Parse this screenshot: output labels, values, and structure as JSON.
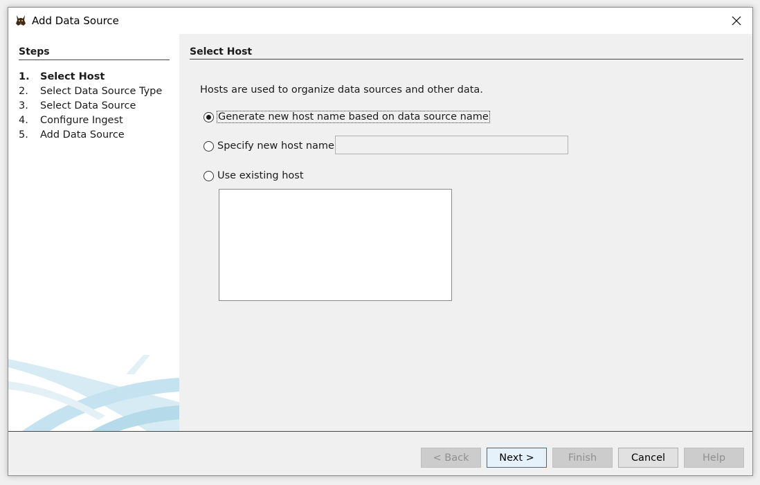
{
  "window": {
    "title": "Add Data Source",
    "icon": "autopsy-dog-icon",
    "close_glyph": "✕"
  },
  "steps": {
    "title": "Steps",
    "items": [
      {
        "number": "1.",
        "label": "Select Host",
        "current": true
      },
      {
        "number": "2.",
        "label": "Select Data Source Type",
        "current": false
      },
      {
        "number": "3.",
        "label": "Select Data Source",
        "current": false
      },
      {
        "number": "4.",
        "label": "Configure Ingest",
        "current": false
      },
      {
        "number": "5.",
        "label": "Add Data Source",
        "current": false
      }
    ]
  },
  "content": {
    "title": "Select Host",
    "intro": "Hosts are used to organize data sources and other data.",
    "options": [
      {
        "label": "Generate new host name based on data source name",
        "checked": true
      },
      {
        "label": "Specify new host name",
        "checked": false
      },
      {
        "label": "Use existing host",
        "checked": false
      }
    ],
    "host_name_input": {
      "value": "",
      "placeholder": ""
    },
    "existing_hosts": []
  },
  "buttons": {
    "back": "< Back",
    "next": "Next >",
    "finish": "Finish",
    "cancel": "Cancel",
    "help": "Help"
  },
  "colors": {
    "primary_button_border": "#0078d7",
    "swoosh": "#bfe0ee"
  }
}
